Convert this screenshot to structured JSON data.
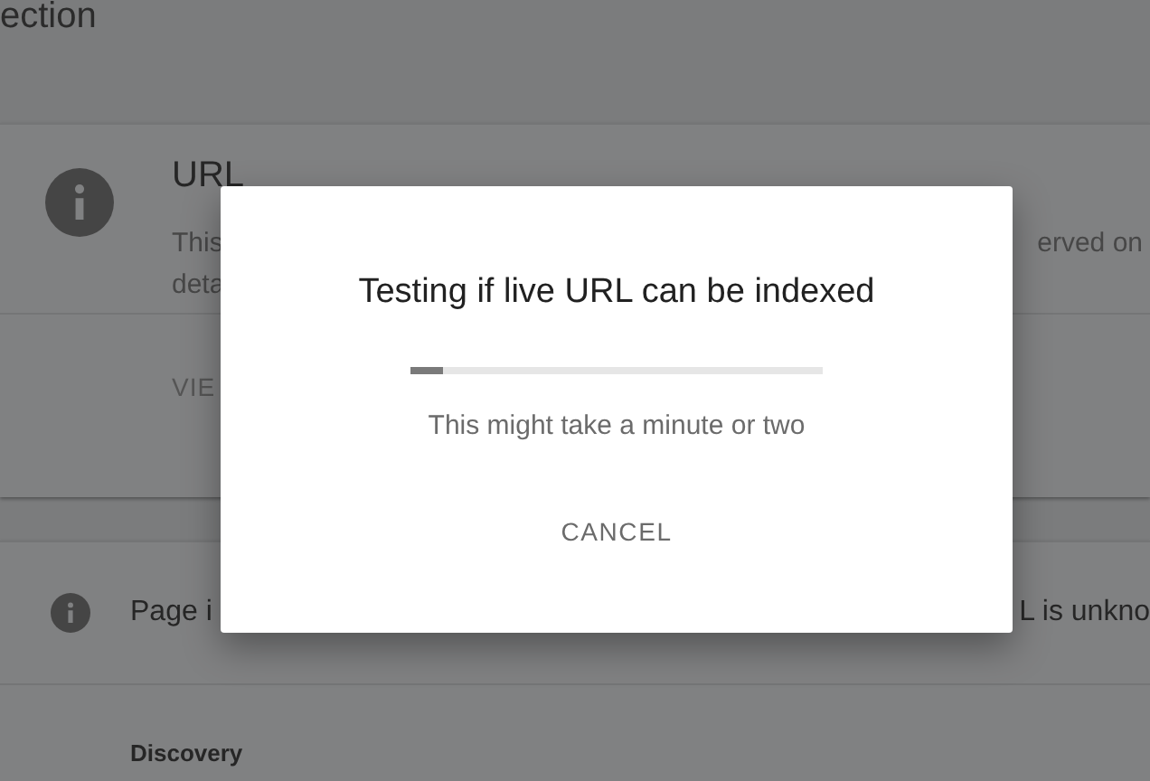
{
  "page_heading": "ection",
  "status_card": {
    "title": "URL",
    "description_left": [
      "This",
      "deta"
    ],
    "description_right": "erved on",
    "action": "VIE"
  },
  "info_row": {
    "text_left": "Page i",
    "text_right": "L is unkno"
  },
  "section_label": "Discovery",
  "dialog": {
    "title": "Testing if live URL can be indexed",
    "progress": {
      "level": 0.08
    },
    "message": "This might take a minute or two",
    "buttons": [
      "CANCEL"
    ]
  }
}
